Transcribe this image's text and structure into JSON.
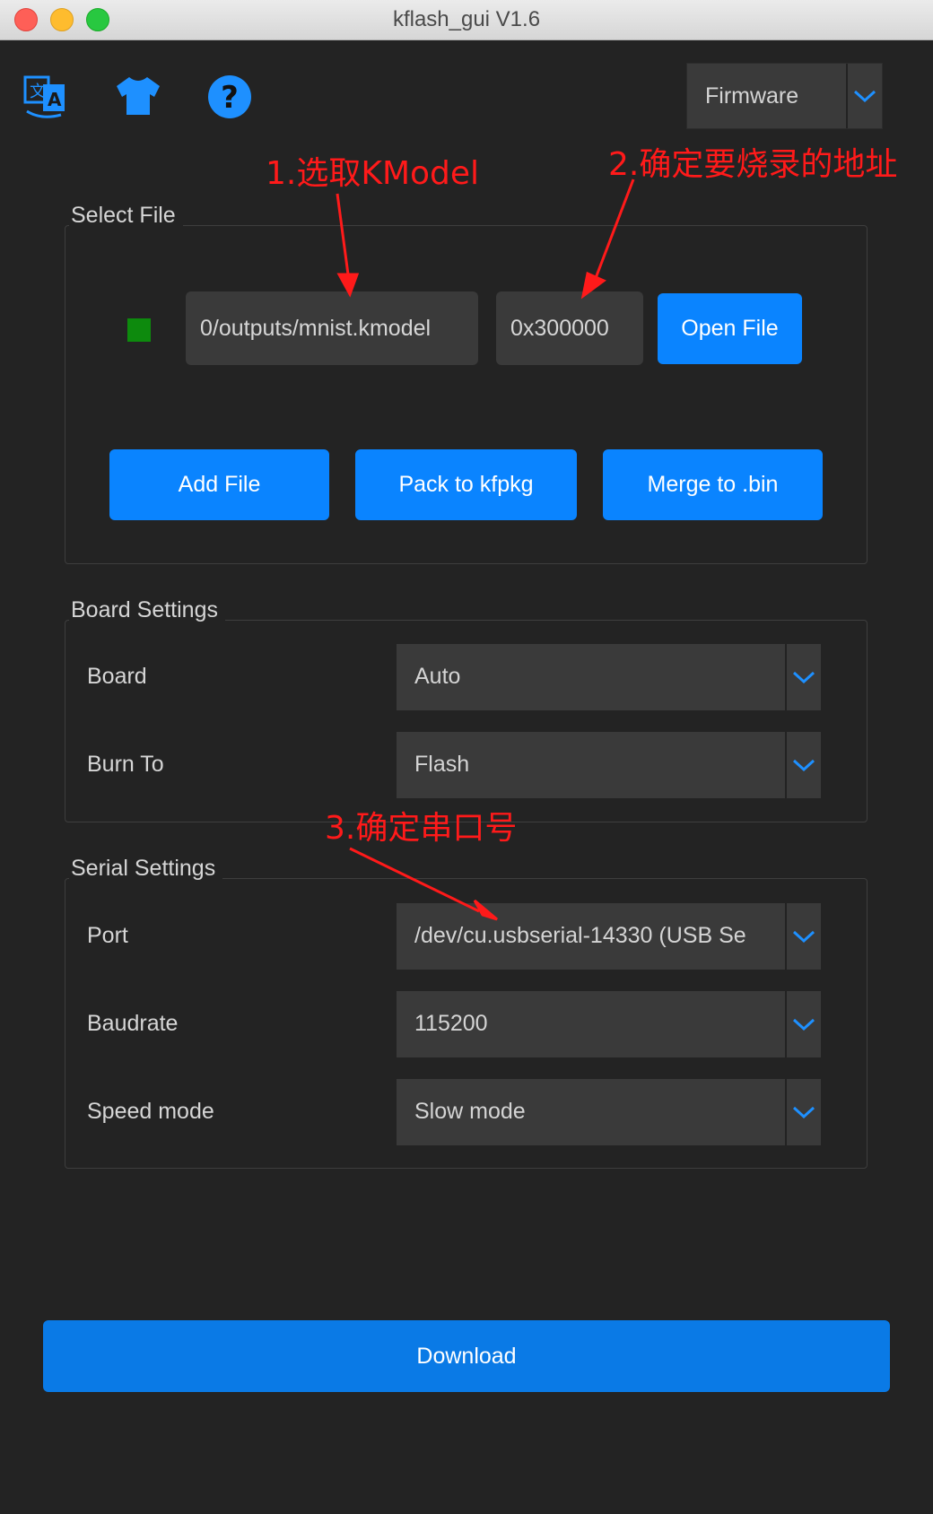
{
  "window": {
    "title": "kflash_gui V1.6"
  },
  "toolbar": {
    "icons": [
      "translate-icon",
      "skin-icon",
      "help-icon"
    ],
    "mode_select": "Firmware"
  },
  "annotations": {
    "step1": "1.选取KModel",
    "step2": "2.确定要烧录的地址",
    "step3": "3.确定串口号"
  },
  "select_file": {
    "title": "Select File",
    "status_color": "#0d8a0d",
    "file_path": "0/outputs/mnist.kmodel",
    "address": "0x300000",
    "open_file": "Open File",
    "add_file": "Add File",
    "pack": "Pack to kfpkg",
    "merge": "Merge to .bin"
  },
  "board_settings": {
    "title": "Board Settings",
    "board_label": "Board",
    "board_value": "Auto",
    "burn_label": "Burn To",
    "burn_value": "Flash"
  },
  "serial_settings": {
    "title": "Serial Settings",
    "port_label": "Port",
    "port_value": "/dev/cu.usbserial-14330 (USB Se",
    "baud_label": "Baudrate",
    "baud_value": "115200",
    "speed_label": "Speed mode",
    "speed_value": "Slow mode"
  },
  "download": "Download",
  "colors": {
    "accent": "#0a84ff",
    "annotation": "#ff1a1a",
    "background": "#232323"
  }
}
